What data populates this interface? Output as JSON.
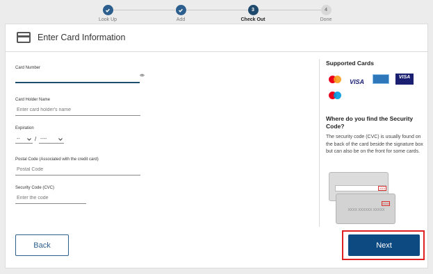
{
  "stepper": {
    "steps": [
      {
        "label": "Look Up",
        "state": "done",
        "number": ""
      },
      {
        "label": "Add",
        "state": "done",
        "number": ""
      },
      {
        "label": "Check Out",
        "state": "current",
        "number": "3"
      },
      {
        "label": "Done",
        "state": "todo",
        "number": "4"
      }
    ]
  },
  "header": {
    "title": "Enter Card Information",
    "icon": "credit-card-icon"
  },
  "form": {
    "card_number": {
      "label": "Card Number",
      "value": "",
      "placeholder": ""
    },
    "holder_name": {
      "label": "Card Holder Name",
      "placeholder": "Enter card holder's name"
    },
    "expiration": {
      "label": "Expiration",
      "month": "--",
      "year": "----",
      "separator": "/"
    },
    "postal_code": {
      "label": "Postal Code (Associated with the credit card)",
      "placeholder": "Postal Code"
    },
    "security_code": {
      "label": "Security Code (CVC)",
      "placeholder": "Enter the code"
    }
  },
  "sidebar": {
    "supported_title": "Supported Cards",
    "cards": [
      "mastercard",
      "visa",
      "american-express",
      "visa-debit",
      "maestro"
    ],
    "visa_text": "VISA",
    "visa_debit_text": "VISA",
    "security_title": "Where do you find the Security Code?",
    "security_text": "The security code (CVC) is usually found on the back of the card beside the signature box but can also be on the front for some cards.",
    "illustration": {
      "back_code": "XXX",
      "front_code": "XXXX",
      "front_number": "XXXX XXXXXX XXXXX"
    }
  },
  "actions": {
    "back_label": "Back",
    "next_label": "Next"
  },
  "colors": {
    "primary": "#0e4a82",
    "highlight": "#e02020",
    "step_done": "#2c5f8d"
  }
}
